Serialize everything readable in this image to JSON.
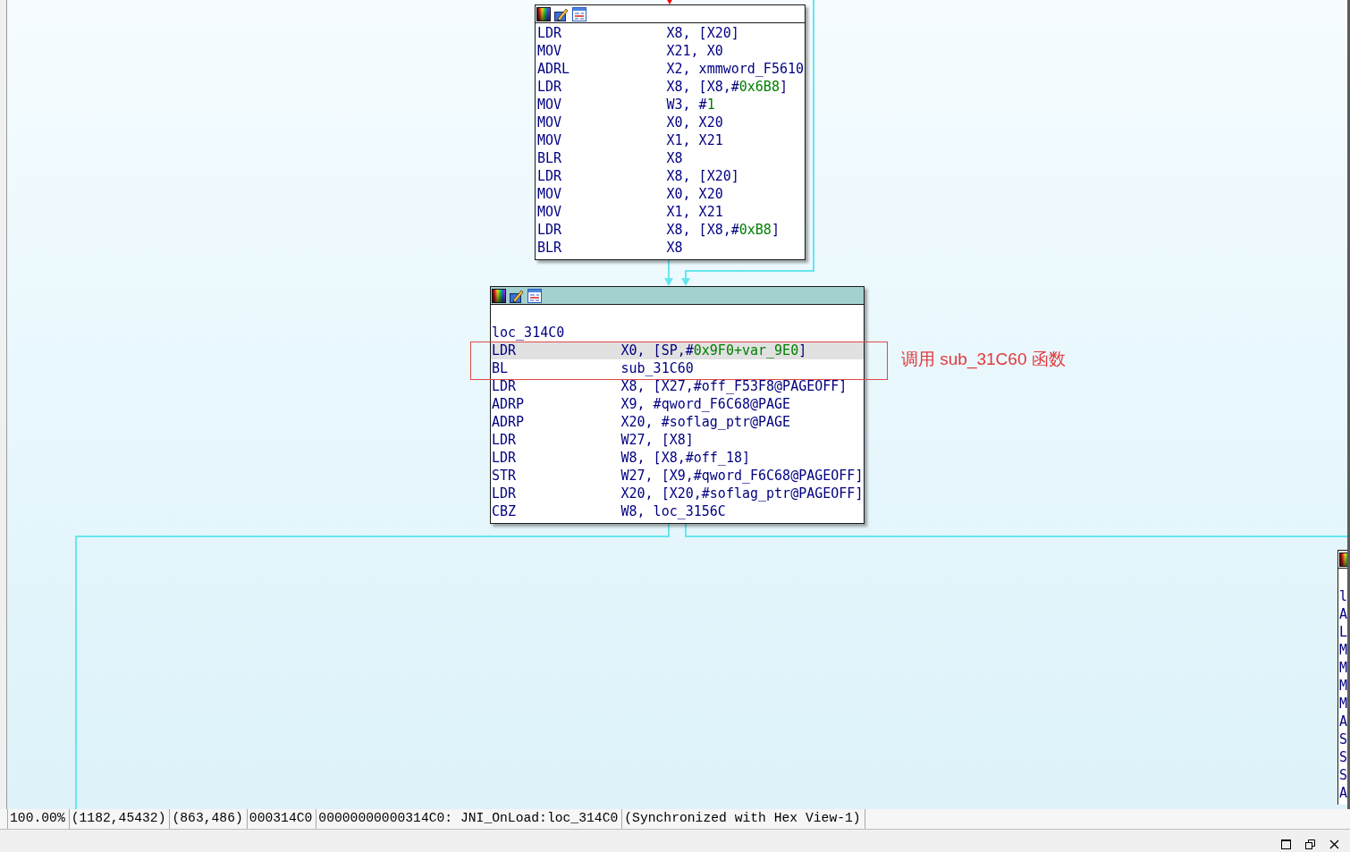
{
  "graph": {
    "nodes": [
      {
        "selected": false,
        "lines": [
          {
            "kind": "instruction",
            "selected": false,
            "mnemonic": "LDR",
            "operands": [
              {
                "kind": "plain",
                "text": "X8, [X20]"
              }
            ]
          },
          {
            "kind": "instruction",
            "selected": false,
            "mnemonic": "MOV",
            "operands": [
              {
                "kind": "plain",
                "text": "X21, X0"
              }
            ]
          },
          {
            "kind": "instruction",
            "selected": false,
            "mnemonic": "ADRL",
            "operands": [
              {
                "kind": "plain",
                "text": "X2, xmmword_F5610"
              }
            ]
          },
          {
            "kind": "instruction",
            "selected": false,
            "mnemonic": "LDR",
            "operands": [
              {
                "kind": "plain",
                "text": "X8, [X8,#"
              },
              {
                "kind": "number",
                "text": "0x6B8"
              },
              {
                "kind": "plain",
                "text": "]"
              }
            ]
          },
          {
            "kind": "instruction",
            "selected": false,
            "mnemonic": "MOV",
            "operands": [
              {
                "kind": "plain",
                "text": "W3, #"
              },
              {
                "kind": "number",
                "text": "1"
              }
            ]
          },
          {
            "kind": "instruction",
            "selected": false,
            "mnemonic": "MOV",
            "operands": [
              {
                "kind": "plain",
                "text": "X0, X20"
              }
            ]
          },
          {
            "kind": "instruction",
            "selected": false,
            "mnemonic": "MOV",
            "operands": [
              {
                "kind": "plain",
                "text": "X1, X21"
              }
            ]
          },
          {
            "kind": "instruction",
            "selected": false,
            "mnemonic": "BLR",
            "operands": [
              {
                "kind": "plain",
                "text": "X8"
              }
            ]
          },
          {
            "kind": "instruction",
            "selected": false,
            "mnemonic": "LDR",
            "operands": [
              {
                "kind": "plain",
                "text": "X8, [X20]"
              }
            ]
          },
          {
            "kind": "instruction",
            "selected": false,
            "mnemonic": "MOV",
            "operands": [
              {
                "kind": "plain",
                "text": "X0, X20"
              }
            ]
          },
          {
            "kind": "instruction",
            "selected": false,
            "mnemonic": "MOV",
            "operands": [
              {
                "kind": "plain",
                "text": "X1, X21"
              }
            ]
          },
          {
            "kind": "instruction",
            "selected": false,
            "mnemonic": "LDR",
            "operands": [
              {
                "kind": "plain",
                "text": "X8, [X8,#"
              },
              {
                "kind": "number",
                "text": "0xB8"
              },
              {
                "kind": "plain",
                "text": "]"
              }
            ]
          },
          {
            "kind": "instruction",
            "selected": false,
            "mnemonic": "BLR",
            "operands": [
              {
                "kind": "plain",
                "text": "X8"
              }
            ]
          }
        ]
      },
      {
        "selected": true,
        "lines": [
          {
            "kind": "label",
            "selected": false,
            "text": "loc_314C0"
          },
          {
            "kind": "instruction",
            "selected": true,
            "mnemonic": "LDR",
            "operands": [
              {
                "kind": "plain",
                "text": "X0, [SP,#"
              },
              {
                "kind": "number",
                "text": "0x9F0+var_9E0"
              },
              {
                "kind": "plain",
                "text": "]"
              }
            ]
          },
          {
            "kind": "instruction",
            "selected": false,
            "mnemonic": "BL",
            "operands": [
              {
                "kind": "plain",
                "text": "sub_31C60"
              }
            ]
          },
          {
            "kind": "instruction",
            "selected": false,
            "mnemonic": "LDR",
            "operands": [
              {
                "kind": "plain",
                "text": "X8, [X27,#off_F53F8@PAGEOFF]"
              }
            ]
          },
          {
            "kind": "instruction",
            "selected": false,
            "mnemonic": "ADRP",
            "operands": [
              {
                "kind": "plain",
                "text": "X9, #qword_F6C68@PAGE"
              }
            ]
          },
          {
            "kind": "instruction",
            "selected": false,
            "mnemonic": "ADRP",
            "operands": [
              {
                "kind": "plain",
                "text": "X20, #soflag_ptr@PAGE"
              }
            ]
          },
          {
            "kind": "instruction",
            "selected": false,
            "mnemonic": "LDR",
            "operands": [
              {
                "kind": "plain",
                "text": "W27, [X8]"
              }
            ]
          },
          {
            "kind": "instruction",
            "selected": false,
            "mnemonic": "LDR",
            "operands": [
              {
                "kind": "plain",
                "text": "W8, [X8,#off_18]"
              }
            ]
          },
          {
            "kind": "instruction",
            "selected": false,
            "mnemonic": "STR",
            "operands": [
              {
                "kind": "plain",
                "text": "W27, [X9,#qword_F6C68@PAGEOFF]"
              }
            ]
          },
          {
            "kind": "instruction",
            "selected": false,
            "mnemonic": "LDR",
            "operands": [
              {
                "kind": "plain",
                "text": "X20, [X20,#soflag_ptr@PAGEOFF]"
              }
            ]
          },
          {
            "kind": "instruction",
            "selected": false,
            "mnemonic": "CBZ",
            "operands": [
              {
                "kind": "plain",
                "text": "W8, loc_3156C"
              }
            ]
          }
        ]
      },
      {
        "selected": false,
        "lines": [
          {
            "kind": "label",
            "selected": false,
            "text": "l"
          },
          {
            "kind": "instruction",
            "selected": false,
            "mnemonic": "A"
          },
          {
            "kind": "instruction",
            "selected": false,
            "mnemonic": "L"
          },
          {
            "kind": "instruction",
            "selected": false,
            "mnemonic": "M"
          },
          {
            "kind": "instruction",
            "selected": false,
            "mnemonic": "M"
          },
          {
            "kind": "instruction",
            "selected": false,
            "mnemonic": "M"
          },
          {
            "kind": "instruction",
            "selected": false,
            "mnemonic": "M"
          },
          {
            "kind": "instruction",
            "selected": false,
            "mnemonic": "A"
          },
          {
            "kind": "instruction",
            "selected": false,
            "mnemonic": "S"
          },
          {
            "kind": "instruction",
            "selected": false,
            "mnemonic": "S"
          },
          {
            "kind": "instruction",
            "selected": false,
            "mnemonic": "S"
          },
          {
            "kind": "instruction",
            "selected": false,
            "mnemonic": "A"
          }
        ]
      }
    ],
    "edges": [
      {
        "color": "#ff0000"
      },
      {
        "color": "#66e6ee"
      },
      {
        "color": "#66e6ee"
      },
      {
        "color": "#66e6ee"
      },
      {
        "color": "#66e6ee"
      }
    ]
  },
  "annotation": {
    "text": "调用 sub_31C60 函数"
  },
  "status_bar": {
    "segments": [
      "100.00%",
      "(1182,45432)",
      "(863,486)",
      "000314C0",
      "00000000000314C0: JNI_OnLoad:loc_314C0",
      "(Synchronized with Hex View-1)"
    ]
  }
}
